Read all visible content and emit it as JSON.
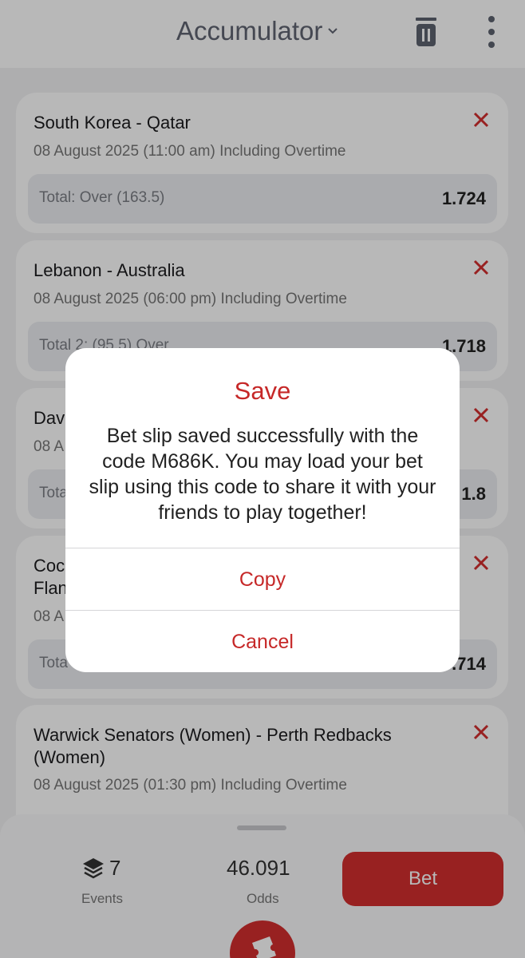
{
  "header": {
    "title": "Accumulator"
  },
  "colors": {
    "accent": "#d32f2f",
    "close_x": "#d32f2f",
    "title_text": "#606572"
  },
  "bets": [
    {
      "match": "South Korea - Qatar",
      "datetime": "08 August 2025 (11:00 am) Including Overtime",
      "market": "Total: Over (163.5)",
      "odd": "1.724"
    },
    {
      "match": "Lebanon - Australia",
      "datetime": "08 August 2025 (06:00 pm) Including Overtime",
      "market": "Total 2: (95.5) Over",
      "odd": "1.718"
    },
    {
      "match": "Dav",
      "datetime": "08 A",
      "market": "Tota",
      "odd": "1.8"
    },
    {
      "match": "Coc\nFlan",
      "datetime": "08 A",
      "market": "Tota",
      "odd": ".714"
    },
    {
      "match": "Warwick Senators (Women) - Perth Redbacks (Women)",
      "datetime": "08 August 2025 (01:30 pm) Including Overtime"
    }
  ],
  "summary": {
    "events_count": "7",
    "events_label": "Events",
    "odds_value": "46.091",
    "odds_label": "Odds",
    "bet_label": "Bet"
  },
  "dialog": {
    "title": "Save",
    "message": "Bet slip saved successfully with the code M686K. You may load your bet slip using this code to share it with your friends to play together!",
    "copy_label": "Copy",
    "cancel_label": "Cancel"
  }
}
